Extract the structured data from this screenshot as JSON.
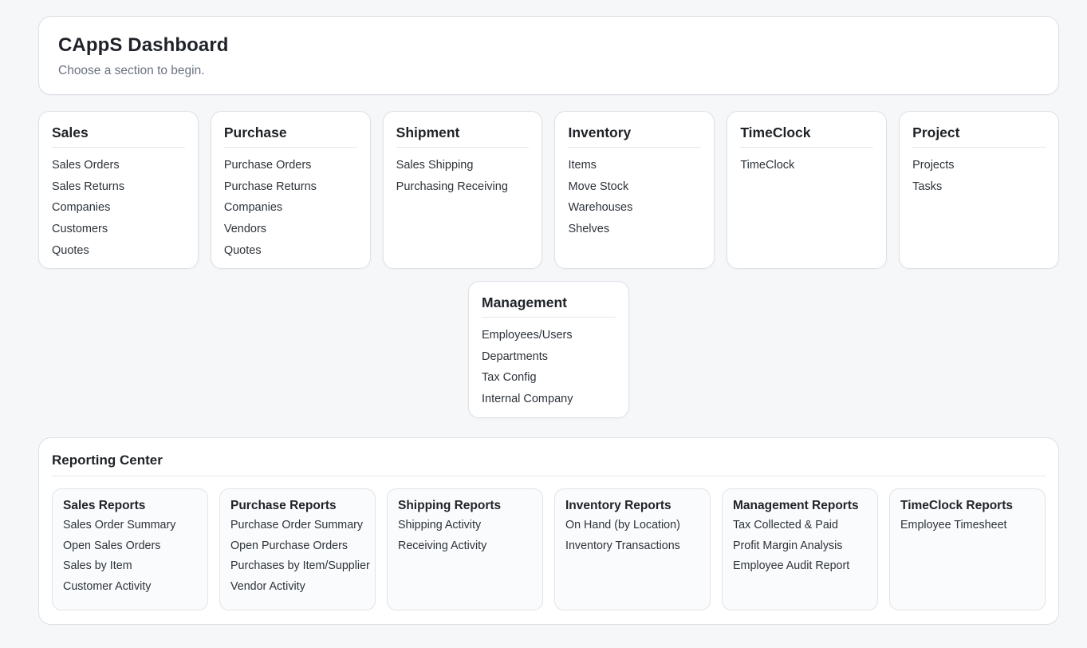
{
  "header": {
    "title": "CAppS Dashboard",
    "subtitle": "Choose a section to begin."
  },
  "sections": [
    {
      "title": "Sales",
      "items": [
        "Sales Orders",
        "Sales Returns",
        "Companies",
        "Customers",
        "Quotes"
      ]
    },
    {
      "title": "Purchase",
      "items": [
        "Purchase Orders",
        "Purchase Returns",
        "Companies",
        "Vendors",
        "Quotes"
      ]
    },
    {
      "title": "Shipment",
      "items": [
        "Sales Shipping",
        "Purchasing Receiving"
      ]
    },
    {
      "title": "Inventory",
      "items": [
        "Items",
        "Move Stock",
        "Warehouses",
        "Shelves"
      ]
    },
    {
      "title": "TimeClock",
      "items": [
        "TimeClock"
      ]
    },
    {
      "title": "Project",
      "items": [
        "Projects",
        "Tasks"
      ]
    }
  ],
  "management": {
    "title": "Management",
    "items": [
      "Employees/Users",
      "Departments",
      "Tax Config",
      "Internal Company"
    ]
  },
  "reporting": {
    "title": "Reporting Center",
    "groups": [
      {
        "title": "Sales Reports",
        "items": [
          "Sales Order Summary",
          "Open Sales Orders",
          "Sales by Item",
          "Customer Activity"
        ]
      },
      {
        "title": "Purchase Reports",
        "items": [
          "Purchase Order Summary",
          "Open Purchase Orders",
          "Purchases by Item/Supplier",
          "Vendor Activity"
        ]
      },
      {
        "title": "Shipping Reports",
        "items": [
          "Shipping Activity",
          "Receiving Activity"
        ]
      },
      {
        "title": "Inventory Reports",
        "items": [
          "On Hand (by Location)",
          "Inventory Transactions"
        ]
      },
      {
        "title": "Management Reports",
        "items": [
          "Tax Collected & Paid",
          "Profit Margin Analysis",
          "Employee Audit Report"
        ]
      },
      {
        "title": "TimeClock Reports",
        "items": [
          "Employee Timesheet"
        ]
      }
    ]
  }
}
